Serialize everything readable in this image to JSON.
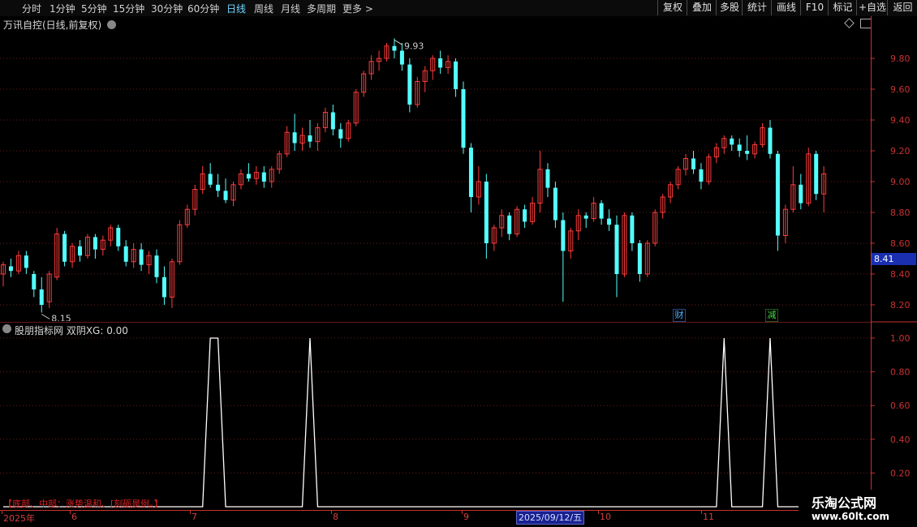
{
  "toolbar": {
    "periods": [
      {
        "label": "分时",
        "active": false
      },
      {
        "label": "1分钟",
        "active": false
      },
      {
        "label": "5分钟",
        "active": false
      },
      {
        "label": "15分钟",
        "active": false
      },
      {
        "label": "30分钟",
        "active": false
      },
      {
        "label": "60分钟",
        "active": false
      },
      {
        "label": "日线",
        "active": true
      },
      {
        "label": "周线",
        "active": false
      },
      {
        "label": "月线",
        "active": false
      },
      {
        "label": "多周期",
        "active": false
      },
      {
        "label": "更多 >",
        "active": false
      }
    ],
    "right_buttons": [
      "复权",
      "叠加",
      "多股",
      "统计",
      "画线",
      "F10",
      "标记",
      "+自选",
      "返回"
    ]
  },
  "stock": {
    "title": "万讯自控(日线,前复权)",
    "last_price_tag": "8.41",
    "high_label": "9.93",
    "low_label": "8.15"
  },
  "indicator": {
    "title": "股朋指标网 双阴XG: 0.00",
    "note": "【底部、中部：涨势温和、[刻砺是例。】"
  },
  "events": [
    {
      "label": "财",
      "color": "#4fb0ff"
    },
    {
      "label": "减",
      "color": "#44dd44"
    }
  ],
  "date_axis": {
    "labels": [
      "2025年",
      "6",
      "7",
      "8",
      "9",
      "10",
      "11"
    ],
    "cursor_label": "2025/09/12/五"
  },
  "watermark": {
    "title": "乐淘公式网",
    "url": "www.60lt.com"
  },
  "colors": {
    "up": "#ff3b3b",
    "down": "#54ffff",
    "axis": "#c83232",
    "grid": "#6a1a1a",
    "ind_line": "#ffffff"
  },
  "chart_data": [
    {
      "type": "candlestick",
      "title": "万讯自控(日线,前复权)",
      "ylim": [
        8.1,
        10.0
      ],
      "yticks": [
        8.2,
        8.4,
        8.6,
        8.8,
        9.0,
        9.2,
        9.4,
        9.6,
        9.8
      ],
      "ohlc": [
        [
          8.4,
          8.48,
          8.32,
          8.46
        ],
        [
          8.45,
          8.5,
          8.38,
          8.42
        ],
        [
          8.42,
          8.55,
          8.4,
          8.52
        ],
        [
          8.52,
          8.55,
          8.4,
          8.44
        ],
        [
          8.4,
          8.42,
          8.25,
          8.3
        ],
        [
          8.3,
          8.38,
          8.15,
          8.2
        ],
        [
          8.22,
          8.42,
          8.18,
          8.4
        ],
        [
          8.38,
          8.7,
          8.36,
          8.66
        ],
        [
          8.66,
          8.68,
          8.45,
          8.48
        ],
        [
          8.48,
          8.6,
          8.44,
          8.58
        ],
        [
          8.58,
          8.62,
          8.48,
          8.52
        ],
        [
          8.52,
          8.66,
          8.5,
          8.64
        ],
        [
          8.64,
          8.66,
          8.5,
          8.56
        ],
        [
          8.56,
          8.65,
          8.52,
          8.62
        ],
        [
          8.62,
          8.72,
          8.58,
          8.7
        ],
        [
          8.7,
          8.72,
          8.55,
          8.58
        ],
        [
          8.58,
          8.62,
          8.45,
          8.48
        ],
        [
          8.48,
          8.6,
          8.44,
          8.56
        ],
        [
          8.56,
          8.6,
          8.42,
          8.46
        ],
        [
          8.46,
          8.55,
          8.4,
          8.52
        ],
        [
          8.52,
          8.56,
          8.34,
          8.38
        ],
        [
          8.38,
          8.45,
          8.2,
          8.25
        ],
        [
          8.25,
          8.5,
          8.18,
          8.48
        ],
        [
          8.48,
          8.75,
          8.46,
          8.72
        ],
        [
          8.72,
          8.85,
          8.7,
          8.82
        ],
        [
          8.82,
          8.98,
          8.78,
          8.95
        ],
        [
          8.95,
          9.1,
          8.92,
          9.05
        ],
        [
          9.05,
          9.12,
          8.96,
          8.98
        ],
        [
          8.98,
          9.05,
          8.9,
          8.94
        ],
        [
          8.94,
          9.02,
          8.86,
          8.88
        ],
        [
          8.88,
          9.0,
          8.84,
          8.98
        ],
        [
          8.98,
          9.08,
          8.95,
          9.05
        ],
        [
          9.05,
          9.12,
          9.0,
          9.02
        ],
        [
          9.02,
          9.1,
          8.98,
          9.06
        ],
        [
          9.06,
          9.1,
          8.96,
          9.0
        ],
        [
          9.0,
          9.1,
          8.96,
          9.08
        ],
        [
          9.08,
          9.2,
          9.05,
          9.18
        ],
        [
          9.18,
          9.36,
          9.16,
          9.32
        ],
        [
          9.32,
          9.44,
          9.2,
          9.25
        ],
        [
          9.25,
          9.35,
          9.2,
          9.3
        ],
        [
          9.3,
          9.4,
          9.22,
          9.26
        ],
        [
          9.26,
          9.38,
          9.2,
          9.35
        ],
        [
          9.35,
          9.48,
          9.32,
          9.45
        ],
        [
          9.45,
          9.5,
          9.3,
          9.34
        ],
        [
          9.34,
          9.38,
          9.22,
          9.28
        ],
        [
          9.28,
          9.4,
          9.26,
          9.38
        ],
        [
          9.38,
          9.6,
          9.36,
          9.58
        ],
        [
          9.58,
          9.72,
          9.55,
          9.7
        ],
        [
          9.7,
          9.82,
          9.66,
          9.78
        ],
        [
          9.78,
          9.85,
          9.72,
          9.8
        ],
        [
          9.8,
          9.9,
          9.78,
          9.88
        ],
        [
          9.88,
          9.93,
          9.8,
          9.85
        ],
        [
          9.85,
          9.9,
          9.72,
          9.76
        ],
        [
          9.76,
          9.8,
          9.45,
          9.5
        ],
        [
          9.5,
          9.68,
          9.48,
          9.65
        ],
        [
          9.65,
          9.75,
          9.58,
          9.72
        ],
        [
          9.72,
          9.82,
          9.66,
          9.8
        ],
        [
          9.8,
          9.85,
          9.7,
          9.74
        ],
        [
          9.74,
          9.82,
          9.7,
          9.78
        ],
        [
          9.78,
          9.8,
          9.55,
          9.6
        ],
        [
          9.6,
          9.65,
          9.18,
          9.22
        ],
        [
          9.22,
          9.25,
          8.8,
          8.9
        ],
        [
          8.9,
          9.1,
          8.85,
          9.0
        ],
        [
          9.0,
          9.05,
          8.5,
          8.6
        ],
        [
          8.6,
          8.72,
          8.55,
          8.7
        ],
        [
          8.7,
          8.82,
          8.64,
          8.78
        ],
        [
          8.78,
          8.8,
          8.62,
          8.66
        ],
        [
          8.66,
          8.84,
          8.64,
          8.82
        ],
        [
          8.82,
          8.85,
          8.7,
          8.74
        ],
        [
          8.74,
          8.9,
          8.72,
          8.86
        ],
        [
          8.86,
          9.2,
          8.8,
          9.08
        ],
        [
          9.08,
          9.12,
          8.9,
          8.96
        ],
        [
          8.96,
          9.0,
          8.7,
          8.75
        ],
        [
          8.75,
          8.8,
          8.22,
          8.55
        ],
        [
          8.55,
          8.7,
          8.5,
          8.68
        ],
        [
          8.68,
          8.82,
          8.62,
          8.78
        ],
        [
          8.78,
          8.8,
          8.7,
          8.76
        ],
        [
          8.76,
          8.9,
          8.74,
          8.86
        ],
        [
          8.86,
          8.88,
          8.72,
          8.76
        ],
        [
          8.76,
          8.82,
          8.68,
          8.72
        ],
        [
          8.72,
          8.78,
          8.25,
          8.4
        ],
        [
          8.4,
          8.8,
          8.38,
          8.78
        ],
        [
          8.78,
          8.8,
          8.55,
          8.6
        ],
        [
          8.6,
          8.62,
          8.35,
          8.4
        ],
        [
          8.4,
          8.62,
          8.38,
          8.6
        ],
        [
          8.6,
          8.82,
          8.58,
          8.8
        ],
        [
          8.8,
          8.92,
          8.76,
          8.9
        ],
        [
          8.9,
          9.0,
          8.86,
          8.98
        ],
        [
          8.98,
          9.1,
          8.95,
          9.08
        ],
        [
          9.08,
          9.18,
          9.04,
          9.15
        ],
        [
          9.15,
          9.2,
          9.05,
          9.08
        ],
        [
          9.08,
          9.12,
          8.95,
          9.0
        ],
        [
          9.0,
          9.18,
          8.98,
          9.16
        ],
        [
          9.16,
          9.25,
          9.12,
          9.22
        ],
        [
          9.22,
          9.3,
          9.18,
          9.28
        ],
        [
          9.28,
          9.3,
          9.2,
          9.24
        ],
        [
          9.24,
          9.28,
          9.16,
          9.2
        ],
        [
          9.2,
          9.3,
          9.14,
          9.18
        ],
        [
          9.18,
          9.26,
          9.15,
          9.24
        ],
        [
          9.24,
          9.38,
          9.22,
          9.35
        ],
        [
          9.35,
          9.4,
          9.15,
          9.18
        ],
        [
          9.18,
          9.2,
          8.55,
          8.65
        ],
        [
          8.65,
          8.85,
          8.6,
          8.82
        ],
        [
          8.82,
          9.1,
          8.8,
          8.98
        ],
        [
          8.98,
          9.05,
          8.82,
          8.86
        ],
        [
          8.86,
          9.22,
          8.84,
          9.18
        ],
        [
          9.18,
          9.2,
          8.88,
          8.92
        ],
        [
          8.92,
          9.1,
          8.8,
          9.05
        ]
      ]
    },
    {
      "type": "line",
      "title": "双阴XG",
      "ylim": [
        0,
        1.05
      ],
      "yticks": [
        0.2,
        0.4,
        0.6,
        0.8,
        1.0
      ],
      "values": [
        0,
        0,
        0,
        0,
        0,
        0,
        0,
        0,
        0,
        0,
        0,
        0,
        0,
        0,
        0,
        0,
        0,
        0,
        0,
        0,
        0,
        0,
        0,
        0,
        0,
        0,
        0,
        1,
        1,
        0,
        0,
        0,
        0,
        0,
        0,
        0,
        0,
        0,
        0,
        0,
        1,
        0,
        0,
        0,
        0,
        0,
        0,
        0,
        0,
        0,
        0,
        0,
        0,
        0,
        0,
        0,
        0,
        0,
        0,
        0,
        0,
        0,
        0,
        0,
        0,
        0,
        0,
        0,
        0,
        0,
        0,
        0,
        0,
        0,
        0,
        0,
        0,
        0,
        0,
        0,
        0,
        0,
        0,
        0,
        0,
        0,
        0,
        0,
        0,
        0,
        0,
        0,
        0,
        0,
        1,
        0,
        0,
        0,
        0,
        0,
        1,
        0,
        0,
        0,
        0,
        0,
        0,
        0,
        0,
        0,
        0
      ]
    }
  ]
}
